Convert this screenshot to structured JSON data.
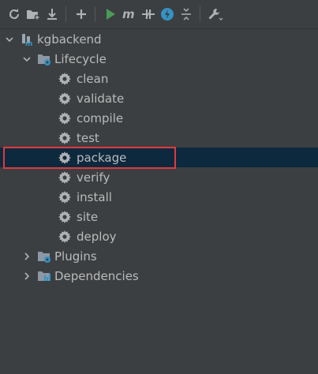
{
  "toolbar": {
    "buttons": [
      {
        "name": "reload-icon",
        "color": "#afb1b3"
      },
      {
        "name": "add-project-icon",
        "color": "#afb1b3"
      },
      {
        "name": "download-sources-icon",
        "color": "#afb1b3"
      },
      {
        "name": "plus-icon",
        "color": "#afb1b3"
      },
      {
        "name": "run-icon",
        "color": "#499c54"
      },
      {
        "name": "maven-goal-icon",
        "color": "#afb1b3"
      },
      {
        "name": "toggle-offline-icon",
        "color": "#afb1b3"
      },
      {
        "name": "skip-tests-icon",
        "color": "#3592c4"
      },
      {
        "name": "collapse-all-icon",
        "color": "#afb1b3"
      },
      {
        "name": "settings-wrench-icon",
        "color": "#afb1b3"
      }
    ]
  },
  "tree": {
    "root": {
      "label": "kgbackend",
      "expanded": true
    },
    "lifecycle": {
      "label": "Lifecycle",
      "expanded": true,
      "goals": [
        "clean",
        "validate",
        "compile",
        "test",
        "package",
        "verify",
        "install",
        "site",
        "deploy"
      ],
      "selected": "package"
    },
    "plugins": {
      "label": "Plugins",
      "expanded": false
    },
    "dependencies": {
      "label": "Dependencies",
      "expanded": false
    }
  },
  "colors": {
    "background": "#3c3f41",
    "selection": "#0d293e",
    "highlight_box": "#e0393e",
    "text": "#bbbbbb",
    "accent_blue": "#3592c4"
  }
}
